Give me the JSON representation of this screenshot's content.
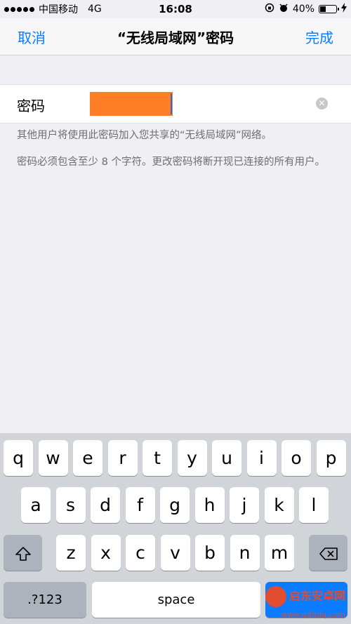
{
  "status_bar": {
    "carrier": "中国移动",
    "network": "4G",
    "time": "16:08",
    "battery_percent": "40%",
    "battery_level": 0.4
  },
  "nav": {
    "cancel_label": "取消",
    "title": "“无线局域网”密码",
    "done_label": "完成"
  },
  "password_row": {
    "label": "密码"
  },
  "notes": {
    "share_info": "其他用户将使用此密码加入您共享的“无线局域网”网络。",
    "requirement": "密码必须包含至少 8 个字符。更改密码将断开现已连接的所有用户。"
  },
  "keyboard": {
    "row1": [
      "q",
      "w",
      "e",
      "r",
      "t",
      "y",
      "u",
      "i",
      "o",
      "p"
    ],
    "row2": [
      "a",
      "s",
      "d",
      "f",
      "g",
      "h",
      "j",
      "k",
      "l"
    ],
    "row3": [
      "z",
      "x",
      "c",
      "v",
      "b",
      "n",
      "m"
    ],
    "numbers_key": ".?123",
    "space_key": "space"
  },
  "watermark": {
    "brand": "启东安卓网",
    "url": "www.qdltdq.com"
  }
}
